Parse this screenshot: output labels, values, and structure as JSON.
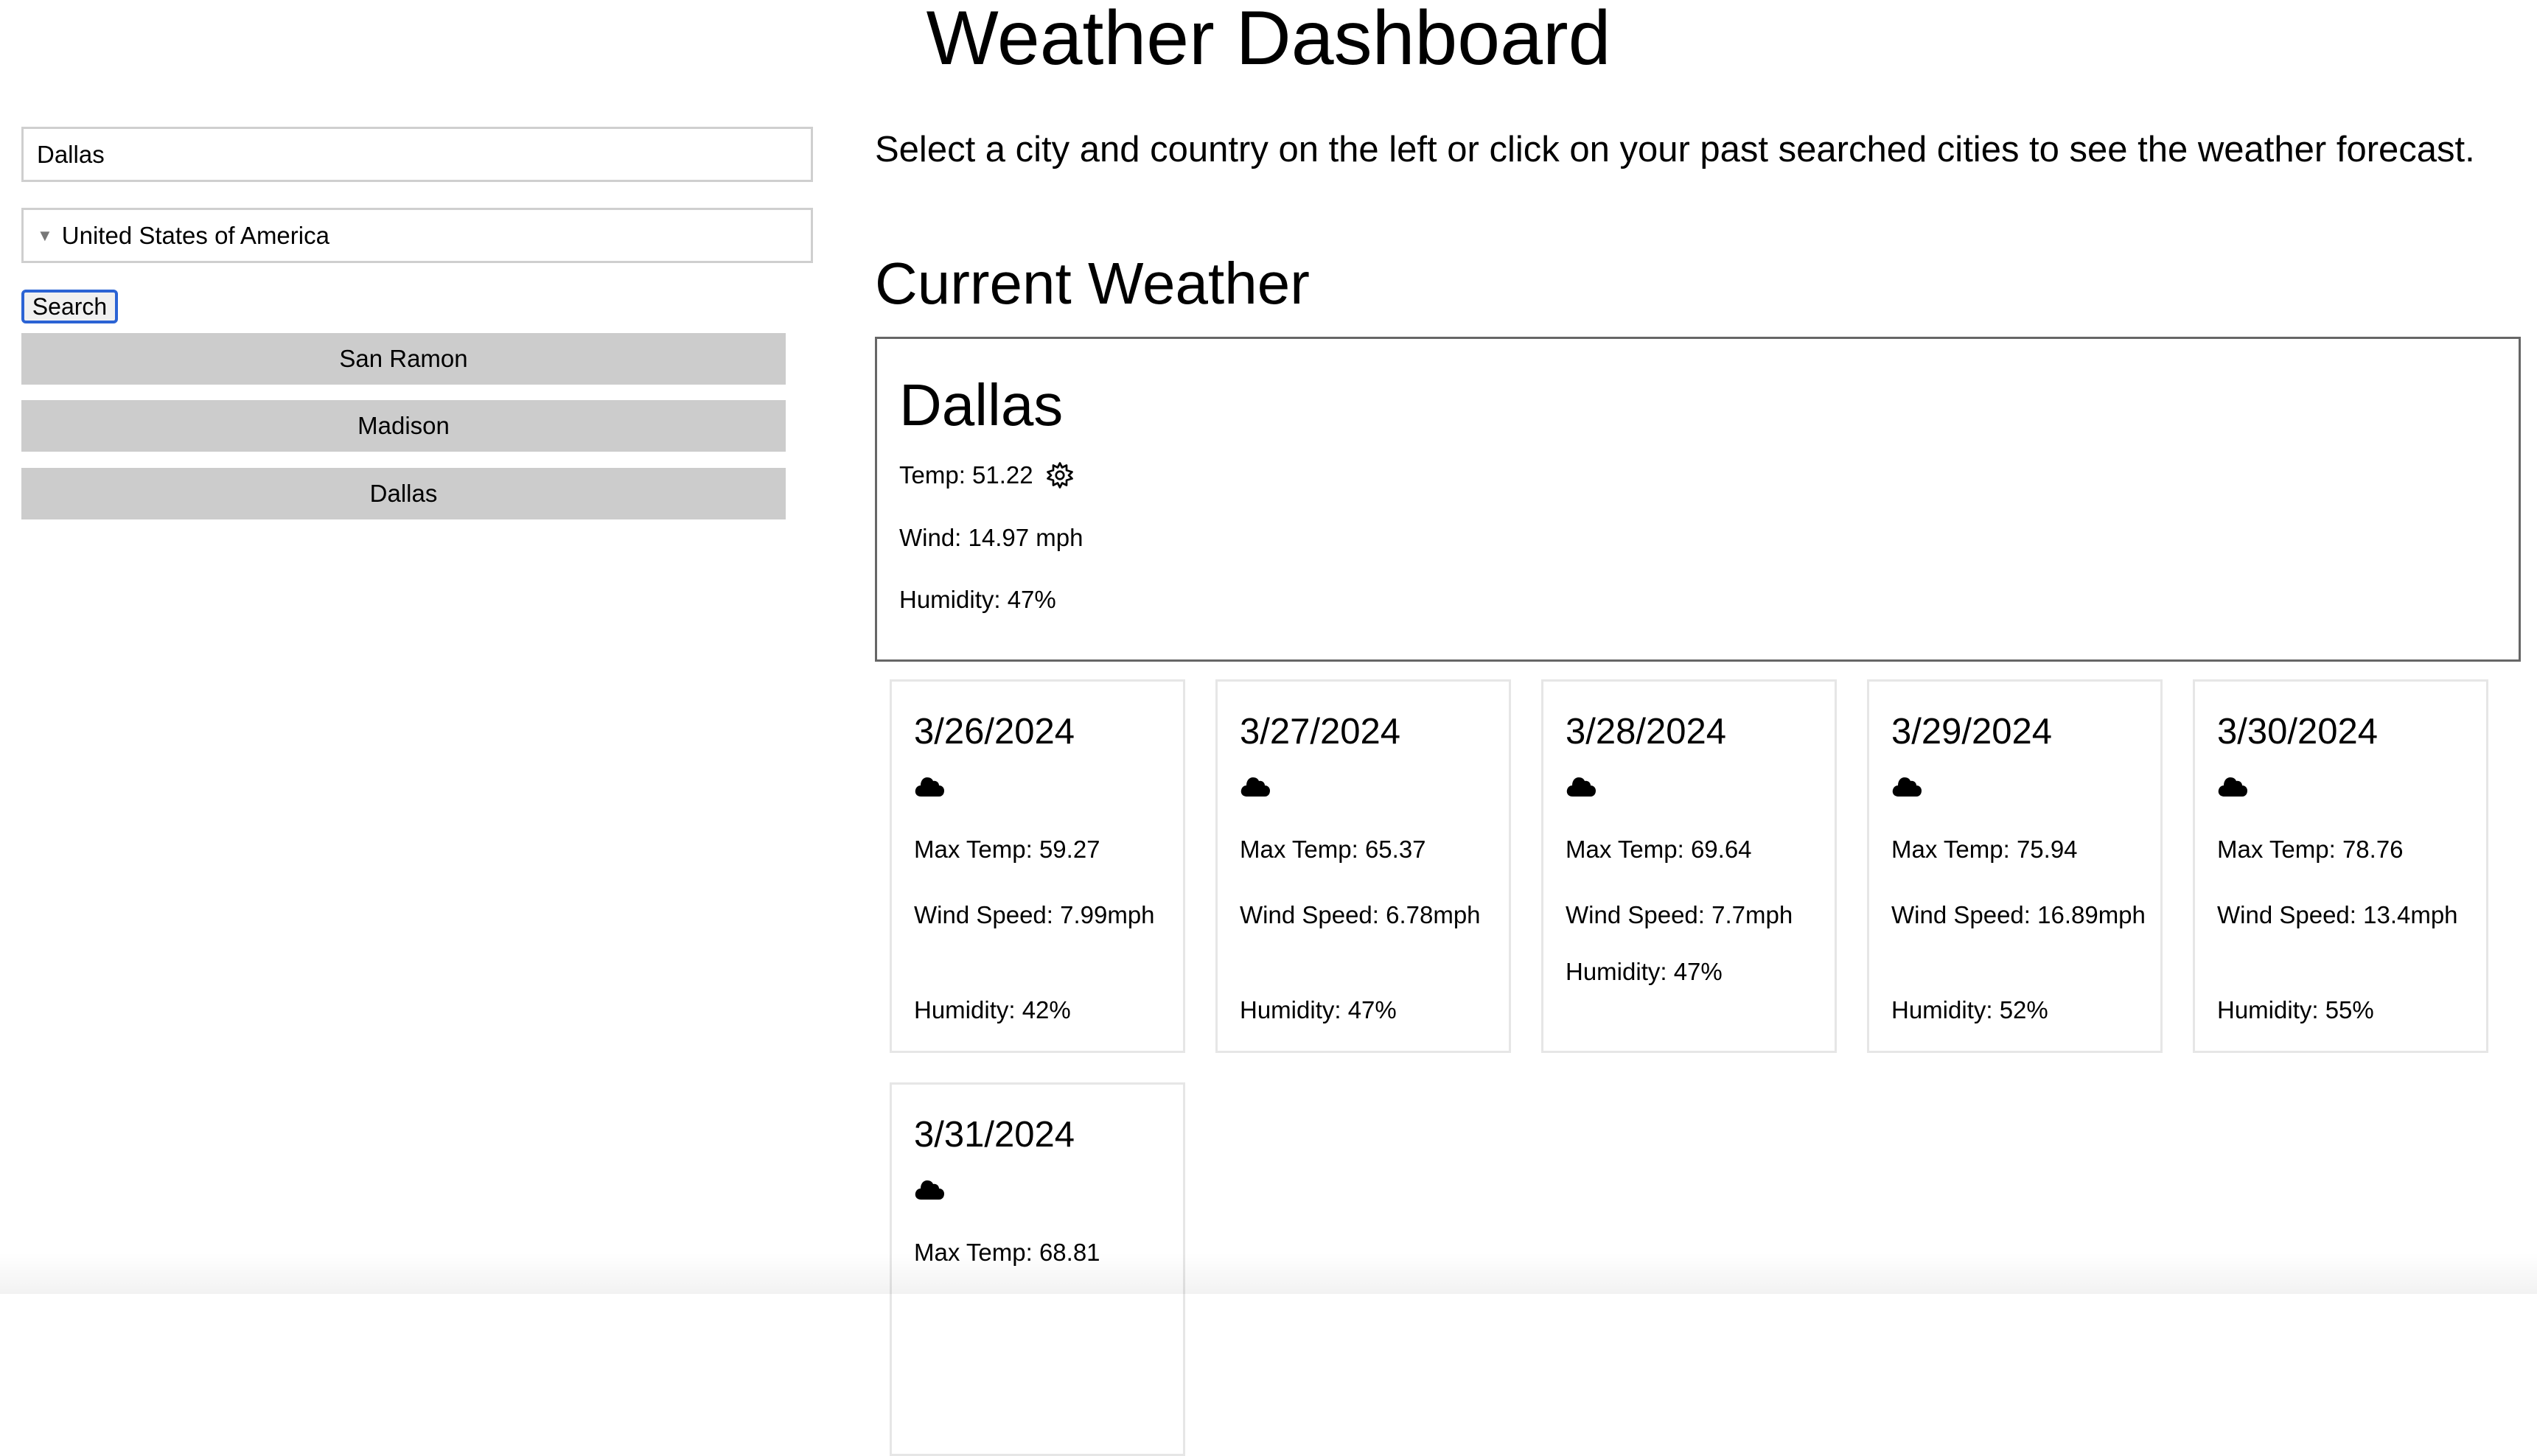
{
  "header": {
    "title": "Weather Dashboard"
  },
  "search": {
    "city_value": "Dallas",
    "country_value": "United States of America",
    "search_label": "Search"
  },
  "history": [
    "San Ramon",
    "Madison",
    "Dallas"
  ],
  "main": {
    "intro": "Select a city and country on the left or click on your past searched cities to see the weather forecast.",
    "current_heading": "Current Weather"
  },
  "current": {
    "city": "Dallas",
    "temp": "Temp: 51.22",
    "icon": "sun-gear-icon",
    "wind": "Wind: 14.97 mph",
    "humidity": "Humidity: 47%"
  },
  "forecast": [
    {
      "date": "3/26/2024",
      "icon": "cloud-icon",
      "max_temp": "Max Temp: 59.27",
      "wind": "Wind Speed: 7.99mph",
      "humidity": "Humidity: 42%"
    },
    {
      "date": "3/27/2024",
      "icon": "cloud-icon",
      "max_temp": "Max Temp: 65.37",
      "wind": "Wind Speed: 6.78mph",
      "humidity": "Humidity: 47%"
    },
    {
      "date": "3/28/2024",
      "icon": "cloud-icon",
      "max_temp": "Max Temp: 69.64",
      "wind": "Wind Speed: 7.7mph",
      "humidity": "Humidity: 47%"
    },
    {
      "date": "3/29/2024",
      "icon": "cloud-icon",
      "max_temp": "Max Temp: 75.94",
      "wind": "Wind Speed: 16.89mph",
      "humidity": "Humidity: 52%"
    },
    {
      "date": "3/30/2024",
      "icon": "cloud-icon",
      "max_temp": "Max Temp: 78.76",
      "wind": "Wind Speed: 13.4mph",
      "humidity": "Humidity: 55%"
    },
    {
      "date": "3/31/2024",
      "icon": "cloud-icon",
      "max_temp": "Max Temp: 68.81",
      "wind": "",
      "humidity": ""
    }
  ],
  "colors": {
    "history_bg": "#cccccc",
    "focus_ring": "#2b63d4",
    "current_border": "#666666",
    "card_border": "#e6e6e6"
  }
}
